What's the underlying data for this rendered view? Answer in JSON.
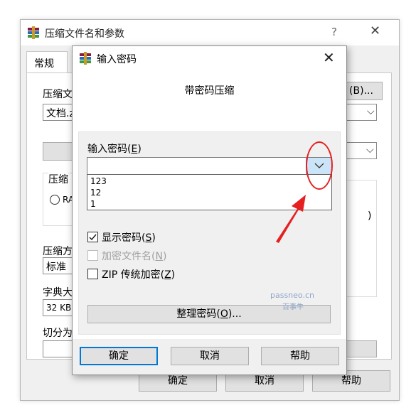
{
  "background_window": {
    "title": "压缩文件名和参数",
    "help_symbol": "?",
    "close_symbol": "✕",
    "tab_general": "常规",
    "label_archive_name": "压缩文",
    "archive_name_value": "文档.z",
    "browse_button": "(B)...",
    "label_update_mode_partial": "压缩",
    "radio_partial": "RA",
    "label_method": "压缩方",
    "method_value": "标准",
    "label_dict": "字典大",
    "dict_value": "32 KB",
    "label_split": "切分为",
    "paren_partial": ")",
    "ok_button": "确定",
    "cancel_button": "取消",
    "help_button": "帮助"
  },
  "dialog": {
    "title": "输入密码",
    "close_symbol": "✕",
    "subtitle": "带密码压缩",
    "password_label": "输入密码(",
    "password_label_key": "E",
    "password_label_end": ")",
    "password_value": "",
    "dropdown_items": [
      "123",
      "12",
      "1"
    ],
    "show_password_label": "显示密码(",
    "show_password_key": "S",
    "show_password_checked": true,
    "encrypt_names_label": "加密文件名(",
    "encrypt_names_key": "N",
    "zip_legacy_label": "ZIP 传统加密(",
    "zip_legacy_key": "Z",
    "organize_button_label": "整理密码(",
    "organize_button_key": "O",
    "organize_button_end": ")...",
    "ok_button": "确定",
    "cancel_button": "取消",
    "help_button": "帮助"
  },
  "watermark": {
    "line1": "passneo.cn",
    "line2": "百事牛"
  },
  "colors": {
    "annotation_red": "#e62020",
    "focus_blue": "#0078d7"
  }
}
